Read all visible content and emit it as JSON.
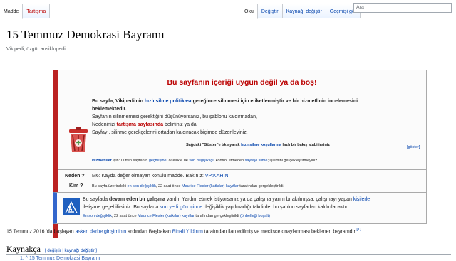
{
  "tabs": {
    "left": [
      {
        "label": "Madde",
        "selected": true
      },
      {
        "label": "Tartışma",
        "red": true
      }
    ],
    "right": [
      "Oku",
      "Değiştir",
      "Kaynağı değiştir",
      "Geçmişi gör"
    ]
  },
  "search": {
    "placeholder": "Ara"
  },
  "page": {
    "title": "15 Temmuz Demokrasi Bayramı",
    "subtitle": "Vikipedi, özgür ansiklopedi"
  },
  "delete_box": {
    "heading": "Bu sayfanın içeriği uygun değil ya da boş!",
    "p1_a": "Bu sayfa, Vikipedi'nin ",
    "p1_link": "hızlı silme politikası",
    "p1_b": " gereğince silinmesi için etiketlenmiştir ve bir hizmetlinin incelemesini",
    "p1_c": "beklemektedir.",
    "p2": "Sayfanın silinmemesi gerektiğini düşünüyorsanız, bu şablonu kaldırmadan,",
    "p3_a": "Nedeninizi ",
    "p3_link": "tartışma sayfasında",
    "p3_b": " belirtiniz ya da",
    "p4": "Sayfayı, silinme gerekçelerini ortadan kaldıracak biçimde düzenleyiniz.",
    "criteria_a": "Sağdaki \"Göster\"e tıklayarak ",
    "criteria_link": "hızlı silme koşullarına",
    "criteria_b": " hızlı bir bakış atabilirsiniz",
    "show_link": "[göster]",
    "admins_label": "Hizmetliler",
    "admins_a": " için: Lütfen sayfanın ",
    "admins_link1": "geçmişine",
    "admins_b": ", özellikle de ",
    "admins_link2": "son değişikliği",
    "admins_c": "; kontrol etmeden ",
    "admins_link3": "sayfayı silme",
    "admins_d": "; işlemini gerçekleştirmeyiniz.",
    "why_label": "Neden ?",
    "why_text": "M6: Kayda değer olmayan konulu madde. Bakınız: ",
    "why_link": "VP:KAHİN",
    "who_label": "Kim ?",
    "who_a": "Bu sayfa üzerindeki ",
    "who_link1": "en son değişiklik",
    "who_b": ", 22 saat önce ",
    "who_link2": "Maurice Flesier (katkılar) kayıtlar",
    "who_c": " tarafından gerçekleştirildi."
  },
  "work_box": {
    "a": "Bu sayfada ",
    "bold": "devam eden bir çalışma",
    "b": " vardır. Yardım etmek istiyorsanız ya da çalışma yarım bırakılmışsa, çalışmayı yapan ",
    "link1": "kişilerle",
    "line2_a": "iletişime geçebilirsiniz. Bu sayfada ",
    "line2_link": "son yedi gün içinde",
    "line2_b": " değişiklik yapılmadığı takdirde, bu şablon sayfadan kaldırılacaktır.",
    "line3_link1": "En son değişiklik",
    "line3_a": ", 22 saat önce ",
    "line3_link2": "Maurice Flesier (katkılar) kayıtlar",
    "line3_b": " tarafından gerçekleştirildi ",
    "line3_link3": "(önbelleği boşalt)"
  },
  "body_text": {
    "a": "15 Temmuz 2016 'da başlayan ",
    "link1": "askeri darbe girişiminin",
    "b": " ardından Başbakan ",
    "link2": "Binali Yıldırım",
    "c": " tarafından ilan edilmiş ve meclisce onaylanması beklenen bayramdır.",
    "ref": "[1]"
  },
  "references": {
    "heading": "Kaynakça",
    "edit": "[ değiştir | kaynağı değiştir ]",
    "item1": "1. ^ 15 Temmuz Demokrasi Bayramı"
  },
  "colors": {
    "delete_border": "#b22222",
    "work_border": "#3366cc",
    "link": "#0645ad",
    "redlink": "#ba0000"
  }
}
